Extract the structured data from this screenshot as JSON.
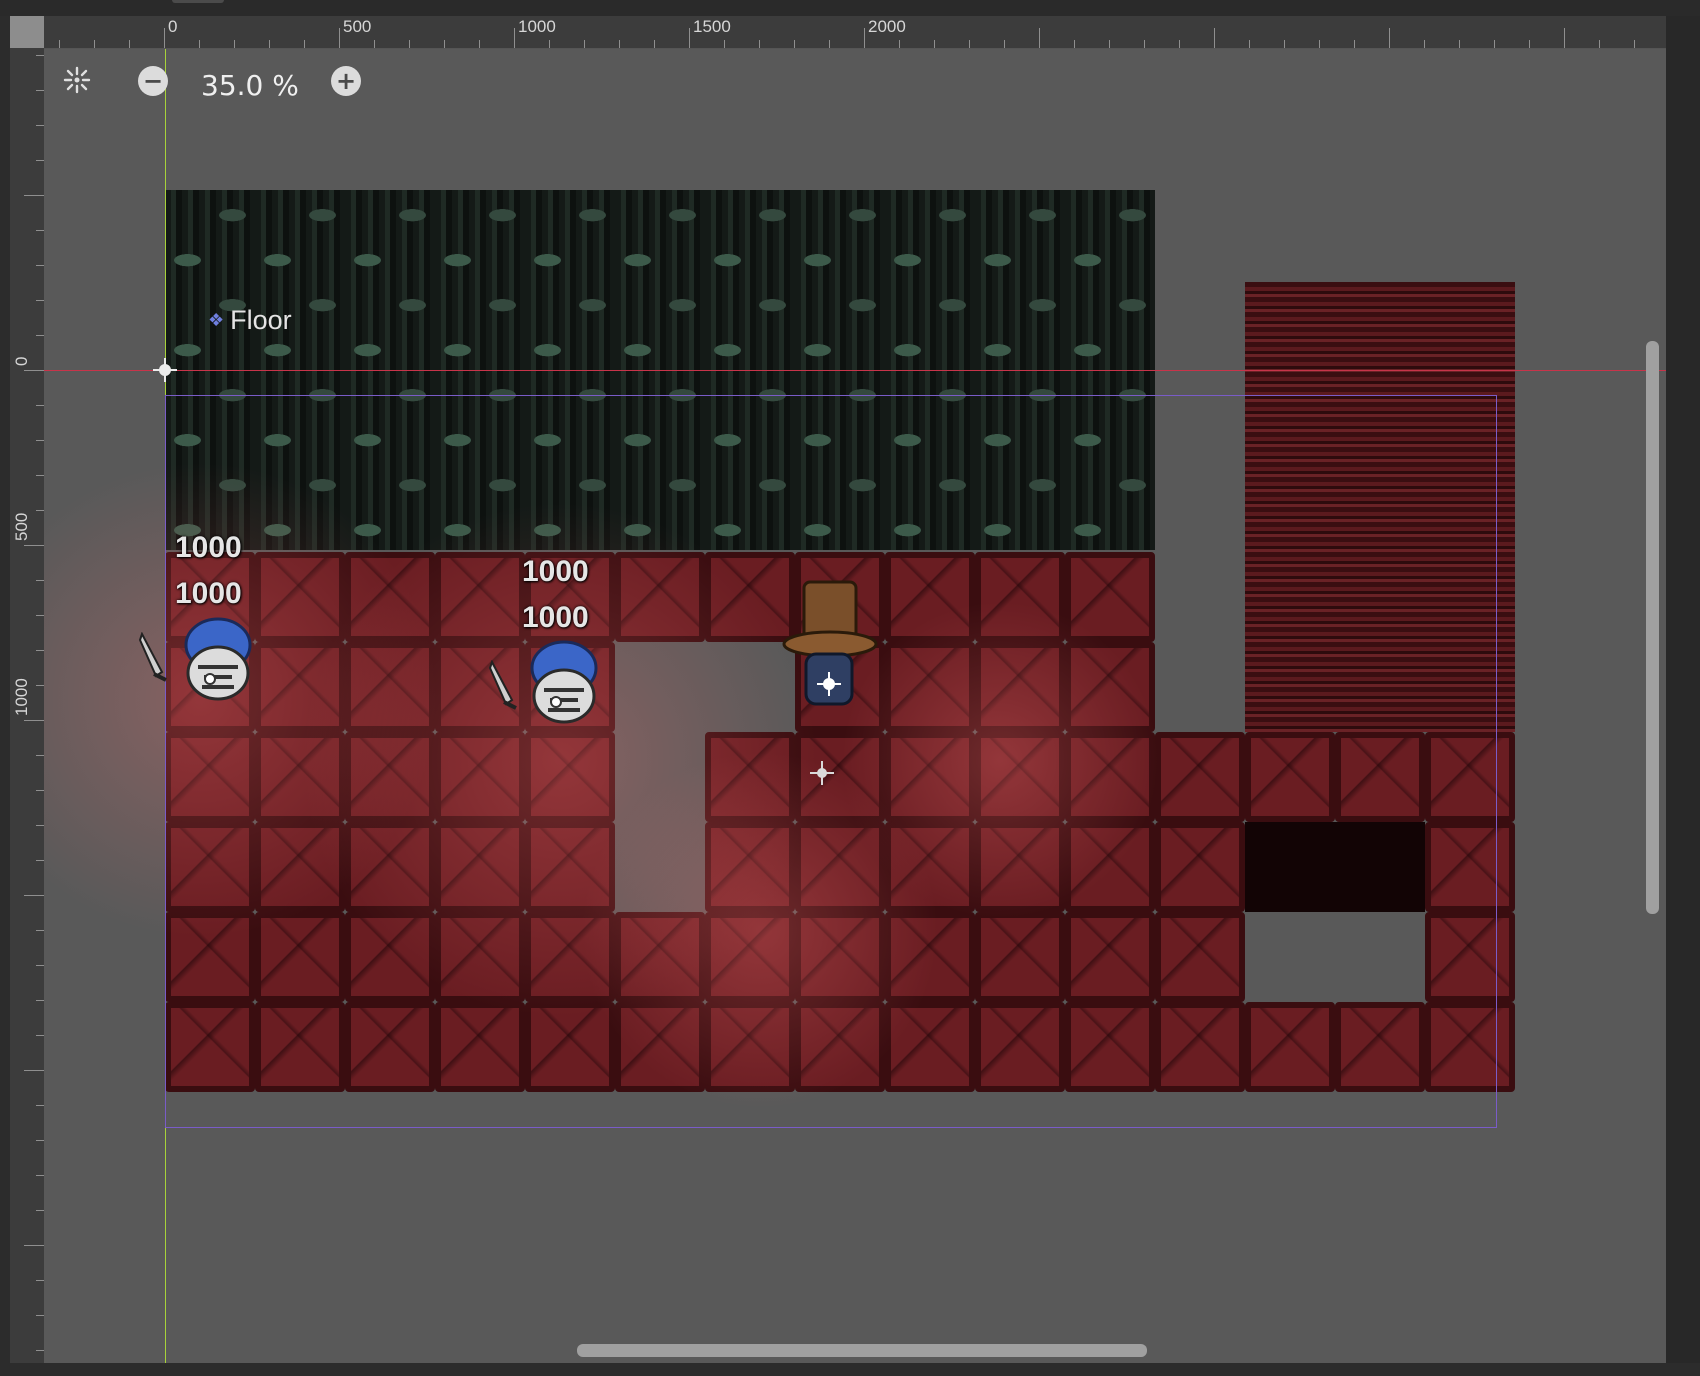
{
  "toolbar": {
    "zoom_text": "35.0 %",
    "zoom_out_symbol": "−",
    "zoom_in_symbol": "+"
  },
  "rulers": {
    "top_labels": [
      "0",
      "500",
      "1000",
      "1500",
      "2000"
    ],
    "left_labels": [
      "0",
      "500",
      "1000"
    ]
  },
  "scene": {
    "node_label": "Floor",
    "node_icon": "tilemap-node-icon",
    "units": [
      {
        "name": "skeleton-knight-1",
        "hp_top": "1000",
        "hp_bottom": "1000"
      },
      {
        "name": "skeleton-knight-2",
        "hp_top": "1000",
        "hp_bottom": "1000"
      },
      {
        "name": "top-hat-player"
      }
    ]
  },
  "colors": {
    "viewport_bg": "#595959",
    "floor_tile": "#6a1d22",
    "wall_tile": "#17201b",
    "origin_line_red": "#c8344a",
    "origin_line_green": "#a8d23a",
    "boundary_purple": "#7a5cc8"
  }
}
